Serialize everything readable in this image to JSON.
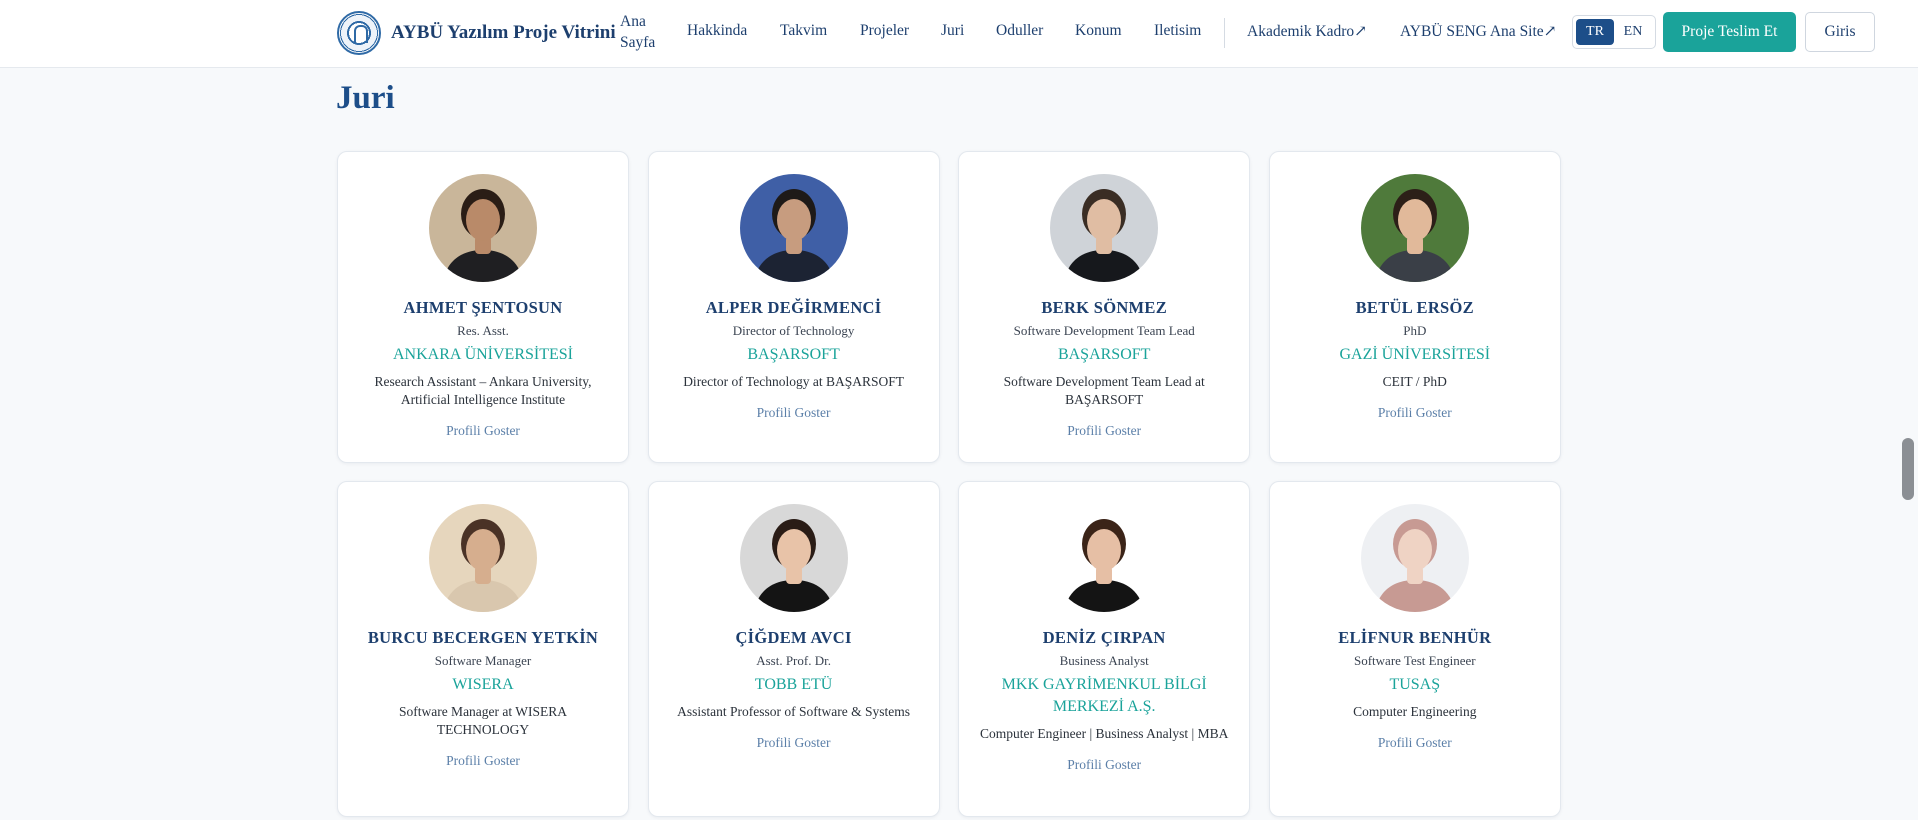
{
  "header": {
    "brand_title": "AYBÜ Yazılım Proje Vitrini",
    "nav": [
      {
        "label": "Ana Sayfa"
      },
      {
        "label": "Hakkinda"
      },
      {
        "label": "Takvim"
      },
      {
        "label": "Projeler"
      },
      {
        "label": "Juri"
      },
      {
        "label": "Oduller"
      },
      {
        "label": "Konum"
      },
      {
        "label": "Iletisim"
      },
      {
        "label": "Akademik Kadro↗"
      },
      {
        "label": "AYBÜ SENG Ana Site↗"
      }
    ],
    "lang": {
      "tr": "TR",
      "en": "EN",
      "active": "TR"
    },
    "submit_label": "Proje Teslim Et",
    "login_label": "Giris"
  },
  "main": {
    "title": "Juri",
    "jury": [
      {
        "name": "AHMET ŞENTOSUN",
        "role": "Res. Asst.",
        "org": "ANKARA ÜNİVERSİTESİ",
        "bio": "Research Assistant – Ankara University, Artificial Intelligence Institute",
        "link": "Profili Goster",
        "avatar": {
          "bg": "#c9b69a",
          "skin": "#b98a69",
          "hair": "#2a1d16",
          "cloth": "#1f1f22"
        }
      },
      {
        "name": "ALPER DEĞİRMENCİ",
        "role": "Director of Technology",
        "org": "BAŞARSOFT",
        "bio": "Director of Technology at BAŞARSOFT",
        "link": "Profili Goster",
        "avatar": {
          "bg": "#3f5fa6",
          "skin": "#c79c7f",
          "hair": "#1e1a18",
          "cloth": "#1c2333"
        }
      },
      {
        "name": "BERK SÖNMEZ",
        "role": "Software Development Team Lead",
        "org": "BAŞARSOFT",
        "bio": "Software Development Team Lead at BAŞARSOFT",
        "link": "Profili Goster",
        "avatar": {
          "bg": "#cfd3d8",
          "skin": "#e0bda3",
          "hair": "#3a2d24",
          "cloth": "#16181c"
        }
      },
      {
        "name": "BETÜL ERSÖZ",
        "role": "PhD",
        "org": "GAZİ ÜNİVERSİTESİ",
        "bio": "CEIT / PhD",
        "link": "Profili Goster",
        "avatar": {
          "bg": "#4f7a3b",
          "skin": "#e1b99a",
          "hair": "#2c1f18",
          "cloth": "#3a3f47"
        }
      },
      {
        "name": "BURCU BECERGEN YETKİN",
        "role": "Software Manager",
        "org": "WISERA",
        "bio": "Software Manager at WISERA TECHNOLOGY",
        "link": "Profili Goster",
        "avatar": {
          "bg": "#e6d6bd",
          "skin": "#d6ae8e",
          "hair": "#4a3226",
          "cloth": "#d9c7ae"
        }
      },
      {
        "name": "ÇİĞDEM AVCI",
        "role": "Asst. Prof. Dr.",
        "org": "TOBB ETÜ",
        "bio": "Assistant Professor of Software & Systems",
        "link": "Profili Goster",
        "avatar": {
          "bg": "#d8d8d8",
          "skin": "#e8c3a8",
          "hair": "#2a1c16",
          "cloth": "#141414"
        }
      },
      {
        "name": "DENİZ ÇIRPAN",
        "role": "Business Analyst",
        "org": "MKK GAYRİMENKUL BİLGİ MERKEZİ A.Ş.",
        "bio": "Computer Engineer | Business Analyst | MBA",
        "link": "Profili Goster",
        "avatar": {
          "bg": "#ffffff",
          "skin": "#e6bfa5",
          "hair": "#3b2418",
          "cloth": "#141414"
        }
      },
      {
        "name": "ELİFNUR BENHÜR",
        "role": "Software Test Engineer",
        "org": "TUSAŞ",
        "bio": "Computer Engineering",
        "link": "Profili Goster",
        "avatar": {
          "bg": "#eef0f3",
          "skin": "#efd3c4",
          "hair": "#c79a93",
          "cloth": "#c79a93"
        }
      }
    ]
  },
  "colors": {
    "accent": "#1aa39a",
    "brand": "#1d4e89"
  }
}
